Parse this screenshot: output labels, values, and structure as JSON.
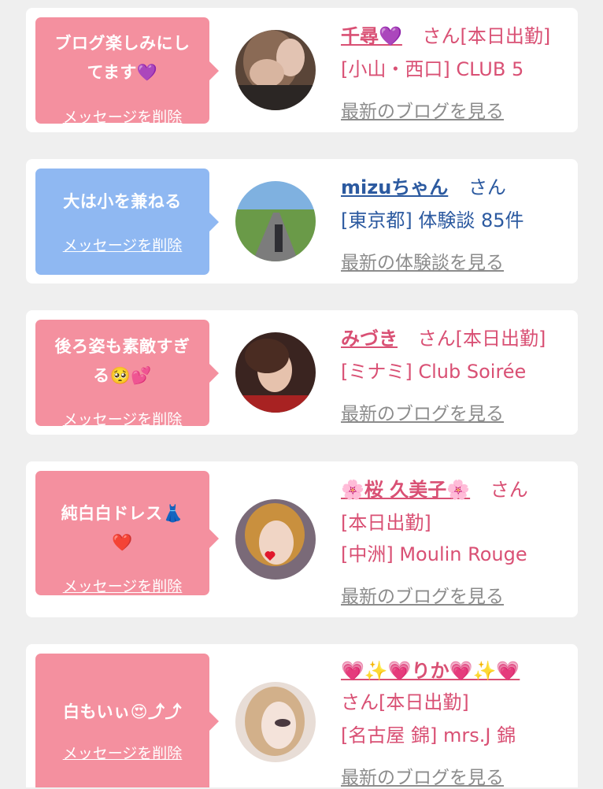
{
  "cards": [
    {
      "message_lines": [
        "ブログ楽しみにし",
        "てます💜"
      ],
      "delete_label": "メッセージを削除",
      "name": "千尋💜",
      "suffix": "さん[本日出勤]",
      "shop": "[小山・西口] CLUB 5",
      "link": "最新のブログを見る"
    },
    {
      "message_lines": [
        "大は小を兼ねる"
      ],
      "delete_label": "メッセージを削除",
      "name": "mizuちゃん",
      "suffix": "さん",
      "shop": "[東京都] 体験談 85件",
      "link": "最新の体験談を見る"
    },
    {
      "message_lines": [
        "後ろ姿も素敵すぎ",
        "る🥺💕"
      ],
      "delete_label": "メッセージを削除",
      "name": "みづき",
      "suffix": "さん[本日出勤]",
      "shop": "[ミナミ] Club Soirée",
      "link": "最新のブログを見る"
    },
    {
      "message_lines": [
        "純白白ドレス👗",
        "❤️"
      ],
      "delete_label": "メッセージを削除",
      "name": "🌸桜 久美子🌸",
      "suffix": "さん",
      "suffix2": "[本日出勤]",
      "shop": "[中洲] Moulin Rouge",
      "link": "最新のブログを見る"
    },
    {
      "message_lines": [
        "白もいぃ😍⤴︎⤴︎"
      ],
      "delete_label": "メッセージを削除",
      "name": "💗✨💗りか💗✨💗",
      "suffix": "さん[本日出勤]",
      "shop": "[名古屋 錦] mrs.J 錦",
      "link": "最新のブログを見る"
    }
  ],
  "colors": {
    "pink_accent": "#d95074",
    "blue_accent": "#2c5aa0",
    "bubble_pink": "#f4909f",
    "bubble_blue": "#8fb8f2"
  }
}
